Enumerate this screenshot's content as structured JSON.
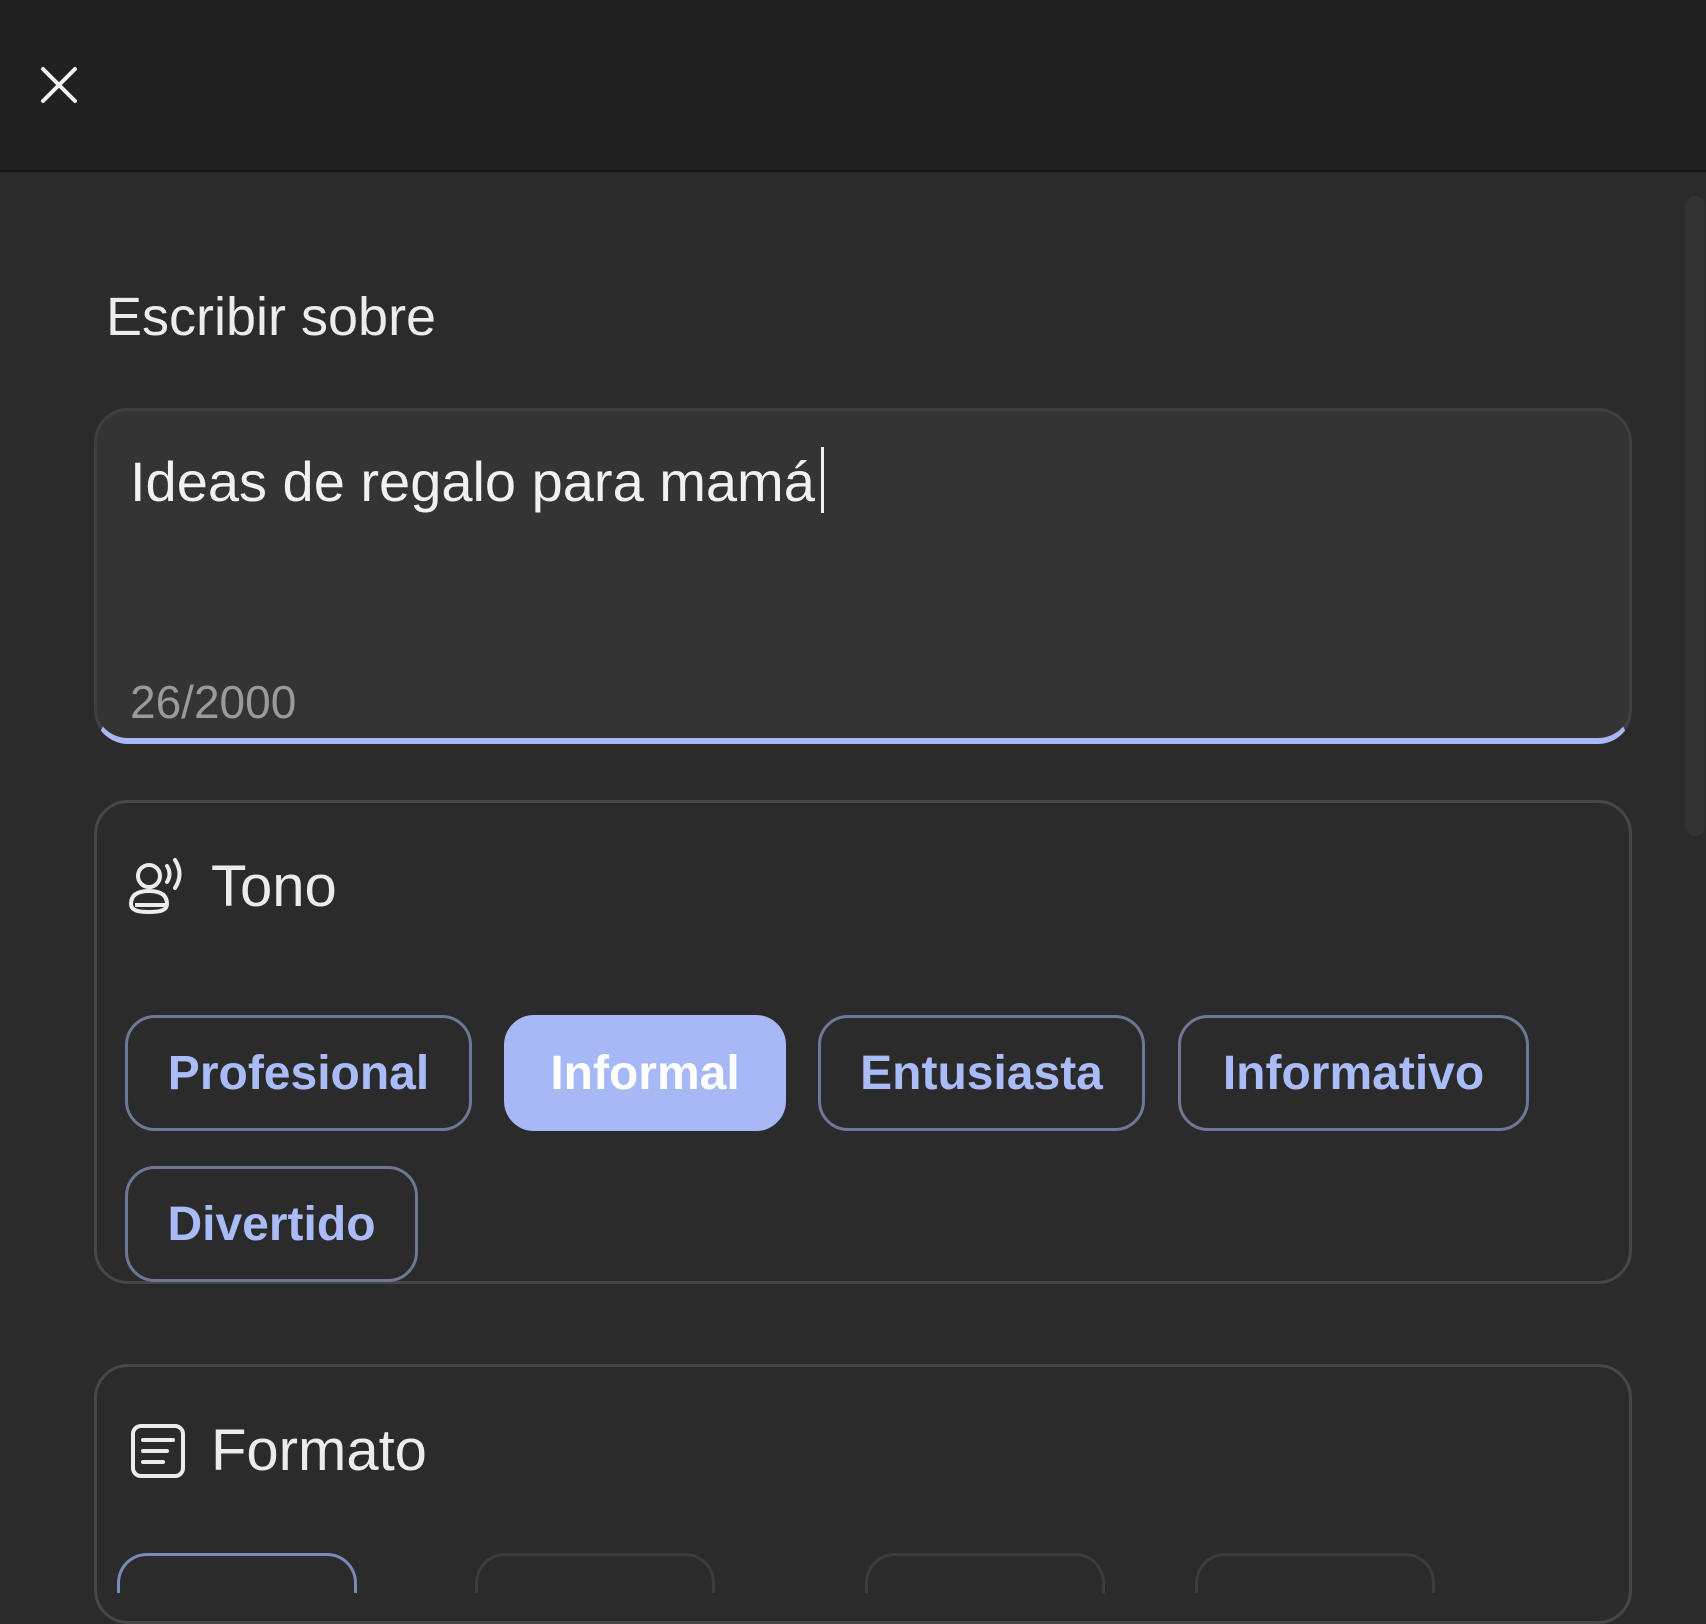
{
  "topbar": {
    "close_icon": "close-icon"
  },
  "editor": {
    "section_label": "Escribir sobre",
    "value": "Ideas de regalo para mamá",
    "counter": "26/2000"
  },
  "tone": {
    "icon": "voice-icon",
    "title": "Tono",
    "options": [
      "Profesional",
      "Informal",
      "Entusiasta",
      "Informativo",
      "Divertido"
    ],
    "selected": "Informal"
  },
  "format": {
    "icon": "document-icon",
    "title": "Formato"
  },
  "colors": {
    "accent": "#a6b8f5",
    "chip_text": "#a9bcf8",
    "background": "#2b2b2b",
    "topbar": "#212121"
  }
}
